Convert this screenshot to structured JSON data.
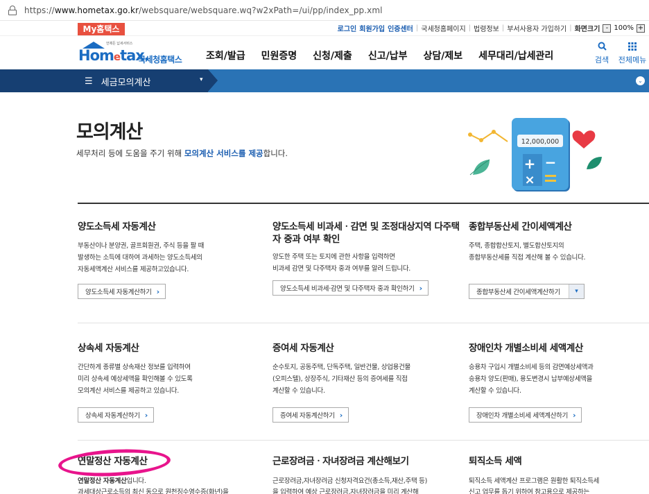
{
  "browser": {
    "url_prefix": "https://",
    "url_host": "www.hometax.go.kr",
    "url_path": "/websquare/websquare.wq?w2xPath=/ui/pp/index_pp.xml"
  },
  "util": {
    "my_hometax": "My홈택스",
    "login": "로그인",
    "signup": "회원가입",
    "cert": "인증센터",
    "links": [
      "국세청홈페이지",
      "법령정보",
      "부서사용자 가입하기"
    ],
    "screen_size": "화면크기",
    "zoom_minus": "-",
    "zoom_value": "100%",
    "zoom_plus": "+"
  },
  "logo": {
    "small_text": "언제든 납세서비스",
    "word_hom": "Hom",
    "word_e": "e",
    "word_tax": "tax.",
    "korean": "국세청홈택스"
  },
  "menu": [
    "조회/발급",
    "민원증명",
    "신청/제출",
    "신고/납부",
    "상담/제보",
    "세무대리/납세관리"
  ],
  "gnb_right": {
    "search_icon": "search-icon",
    "search": "검색",
    "grid_icon": "grid-icon",
    "all_menu": "전체메뉴"
  },
  "bluebar": {
    "menu_icon": "hamburger-icon",
    "label": "세금모의계산",
    "caret": "▾",
    "expand": "⌄"
  },
  "hero": {
    "title": "모의계산",
    "desc_pre": "세무처리 등에 도움을 주기 위해 ",
    "desc_hl": "모의계산 서비스를 제공",
    "desc_post": "합니다.",
    "calc_display": "12,000,000"
  },
  "cards": [
    {
      "title": "양도소득세 자동계산",
      "desc": [
        "부동산이나 분양권, 골프회원권, 주식 등을 팔 때",
        "발생하는 소득에 대하여 과세하는 양도소득세의",
        "자동세액계산 서비스를 제공하고있습니다."
      ],
      "button": "양도소득세 자동계산하기"
    },
    {
      "title": "양도소득세 비과세ㆍ감면 및 조정대상지역 다주택자 중과 여부 확인",
      "desc": [
        "양도한 주택 또는 토지에 관한 사항을 입력하면",
        "비과세 감면 및 다주택자 중과 여부를 알려 드립니다."
      ],
      "button": "양도소득세 비과세·감면 및 다주택자 중과 확인하기"
    },
    {
      "title": "종합부동산세 간이세액계산",
      "desc": [
        "주택, 종합합산토지, 별도합산토지의",
        "종합부동산세를 직접 계산해 볼 수 있습니다."
      ],
      "button": "종합부동산세 간이세액계산하기"
    },
    {
      "title": "상속세 자동계산",
      "desc": [
        "간단하게 종류별 상속재산 정보를 입력하여",
        "미리 상속세 예상세액을 확인해볼 수 있도록",
        "모의계산 서비스를 제공하고 있습니다."
      ],
      "button": "상속세 자동계산하기"
    },
    {
      "title": "증여세 자동계산",
      "desc": [
        "순수토지, 공동주택, 단독주택, 일반건물, 상업용건물",
        "(오피스텔), 상장주식, 기타재산 등의 증여세를 직접",
        "계산할 수 있습니다."
      ],
      "button": "증여세 자동계산하기"
    },
    {
      "title": "장애인차 개별소비세 세액계산",
      "desc": [
        "승용차 구입시 개별소비세 등의 감면예상세액과",
        "승용차 양도(판매), 용도변경시 납부예상세액을",
        "계산할 수 있습니다."
      ],
      "button": "장애인차 개별소비세 세액계산하기"
    },
    {
      "title": "연말정산 자동계산",
      "desc_bold": "연말정산 자동계산",
      "desc_tail": "입니다.",
      "desc2": "과세대상근로소득의 최신 동으로 원천징수영수증(화년)을"
    },
    {
      "title": "근로장려금ㆍ자녀장려금 계산해보기",
      "desc": [
        "근로장려금,자녀장려금 신청자격요건(총소득,재산,주택 등)",
        "을 입력하여 예상 근로장려금,자녀장려금을 미리 계산해"
      ]
    },
    {
      "title": "퇴직소득 세액",
      "desc": [
        "퇴직소득 세액계산 프로그램은 원활한 퇴직소득세",
        "신고 업무를 돕기 위하여 참고용으로 제공하는"
      ]
    }
  ]
}
